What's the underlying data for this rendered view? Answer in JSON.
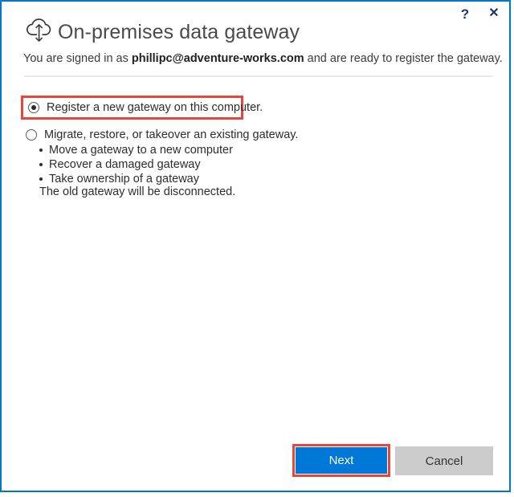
{
  "window": {
    "accent_border_color": "#0078c8",
    "background": "#ffffff"
  },
  "titlebar": {
    "help_icon": "?",
    "help_icon_name": "help-icon",
    "close_icon": "✕",
    "close_icon_name": "close-icon"
  },
  "header": {
    "icon_name": "cloud-sync-icon",
    "title": "On-premises data gateway"
  },
  "signin": {
    "prefix": "You are signed in as",
    "email": "phillipc@adventure-works.com",
    "suffix": "and are ready to register the gateway."
  },
  "options": [
    {
      "id": "register-new",
      "label": "Register a new gateway on this computer.",
      "selected": true,
      "highlighted": true,
      "highlight_color": "#e8453c"
    },
    {
      "id": "migrate-restore-takeover",
      "label": "Migrate, restore, or takeover an existing gateway.",
      "selected": false,
      "highlighted": false,
      "bullets": [
        "Move a gateway to a new computer",
        "Recover a damaged gateway",
        "Take ownership of a gateway"
      ],
      "footnote": "The old gateway will be disconnected."
    }
  ],
  "footer": {
    "next_label": "Next",
    "next_color": "#0078d7",
    "next_highlighted": true,
    "highlight_color": "#e8453c",
    "cancel_label": "Cancel",
    "cancel_color": "#cccccc"
  }
}
